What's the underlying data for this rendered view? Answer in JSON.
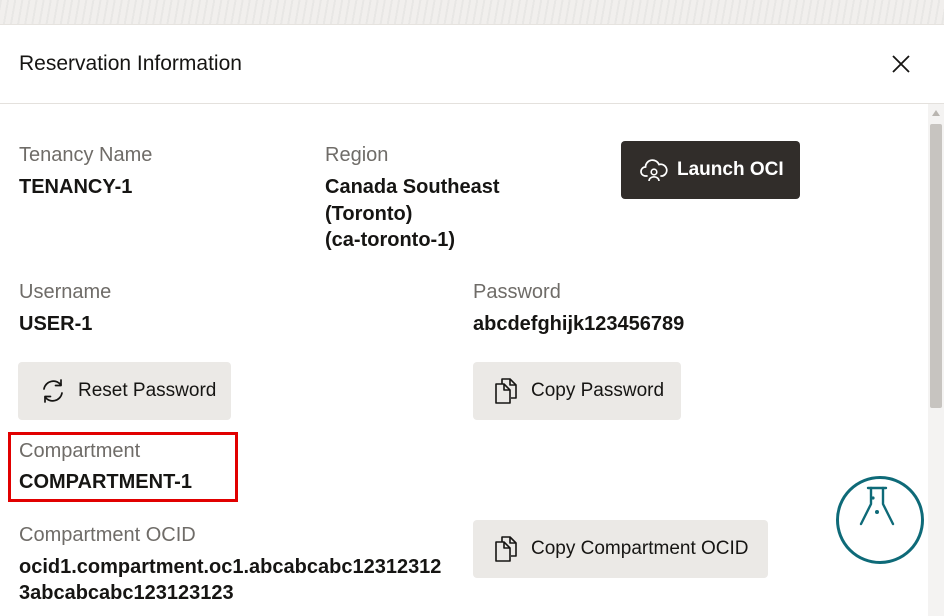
{
  "dialog": {
    "title": "Reservation Information",
    "close_icon": "close-icon"
  },
  "fields": {
    "tenancy_label": "Tenancy Name",
    "tenancy_value": "TENANCY-1",
    "region_label": "Region",
    "region_value_line1": "Canada Southeast",
    "region_value_line2": "(Toronto)",
    "region_value_line3": "(ca-toronto-1)",
    "username_label": "Username",
    "username_value": "USER-1",
    "password_label": "Password",
    "password_value": "abcdefghijk123456789",
    "compartment_label": "Compartment",
    "compartment_value": "COMPARTMENT-1",
    "compartment_ocid_label": "Compartment OCID",
    "compartment_ocid_line1": "ocid1.compartment.oc1.abcabcabc12312312",
    "compartment_ocid_line2": "3abcabcabc123123123"
  },
  "buttons": {
    "launch_oci": "Launch OCI",
    "reset_password": "Reset Password",
    "copy_password": "Copy Password",
    "copy_compartment_ocid": "Copy Compartment OCID"
  },
  "icons": {
    "launch": "cloud-user-icon",
    "reset": "refresh-icon",
    "copy": "copy-icon",
    "lab": "flask-icon"
  },
  "colors": {
    "primary_button": "#312d2a",
    "secondary_button": "#ebe9e6",
    "highlight": "#e10000",
    "lab_accent": "#0e6a78"
  }
}
